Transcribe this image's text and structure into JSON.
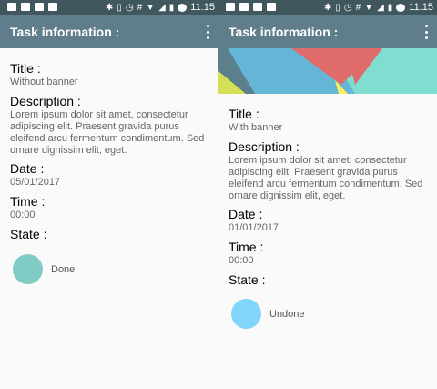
{
  "status_bar": {
    "time": "11:15",
    "hash": "#"
  },
  "screens": [
    {
      "toolbar_title": "Task information :",
      "fields": {
        "title_label": "Title :",
        "title_value": "Without banner",
        "description_label": "Description :",
        "description_value": "Lorem ipsum dolor sit amet, consectetur adipiscing elit. Praesent gravida purus eleifend arcu fermentum condimentum. Sed ornare dignissim elit, eget.",
        "date_label": "Date :",
        "date_value": "05/01/2017",
        "time_label": "Time :",
        "time_value": "00:00",
        "state_label": "State :",
        "state_value": "Done"
      },
      "state_color": "#80cbc4",
      "has_banner": false
    },
    {
      "toolbar_title": "Task information :",
      "fields": {
        "title_label": "Title :",
        "title_value": "With banner",
        "description_label": "Description :",
        "description_value": "Lorem ipsum dolor sit amet, consectetur adipiscing elit. Praesent gravida purus eleifend arcu fermentum condimentum. Sed ornare dignissim elit, eget.",
        "date_label": "Date :",
        "date_value": "01/01/2017",
        "time_label": "Time :",
        "time_value": "00:00",
        "state_label": "State :",
        "state_value": "Undone"
      },
      "state_color": "#81d4fa",
      "has_banner": true
    }
  ],
  "colors": {
    "status_bar": "#3f575d",
    "toolbar": "#607d8b",
    "background": "#fafafa"
  },
  "icons": {
    "status_left": [
      "image-icon",
      "video-icon",
      "briefcase-icon",
      "android-icon"
    ],
    "status_right": [
      "bluetooth-icon",
      "vibrate-icon",
      "alarm-icon",
      "hash-icon",
      "wifi-icon",
      "signal-icon",
      "battery-icon",
      "clock-icon"
    ],
    "toolbar_menu": "more-vert-icon"
  }
}
